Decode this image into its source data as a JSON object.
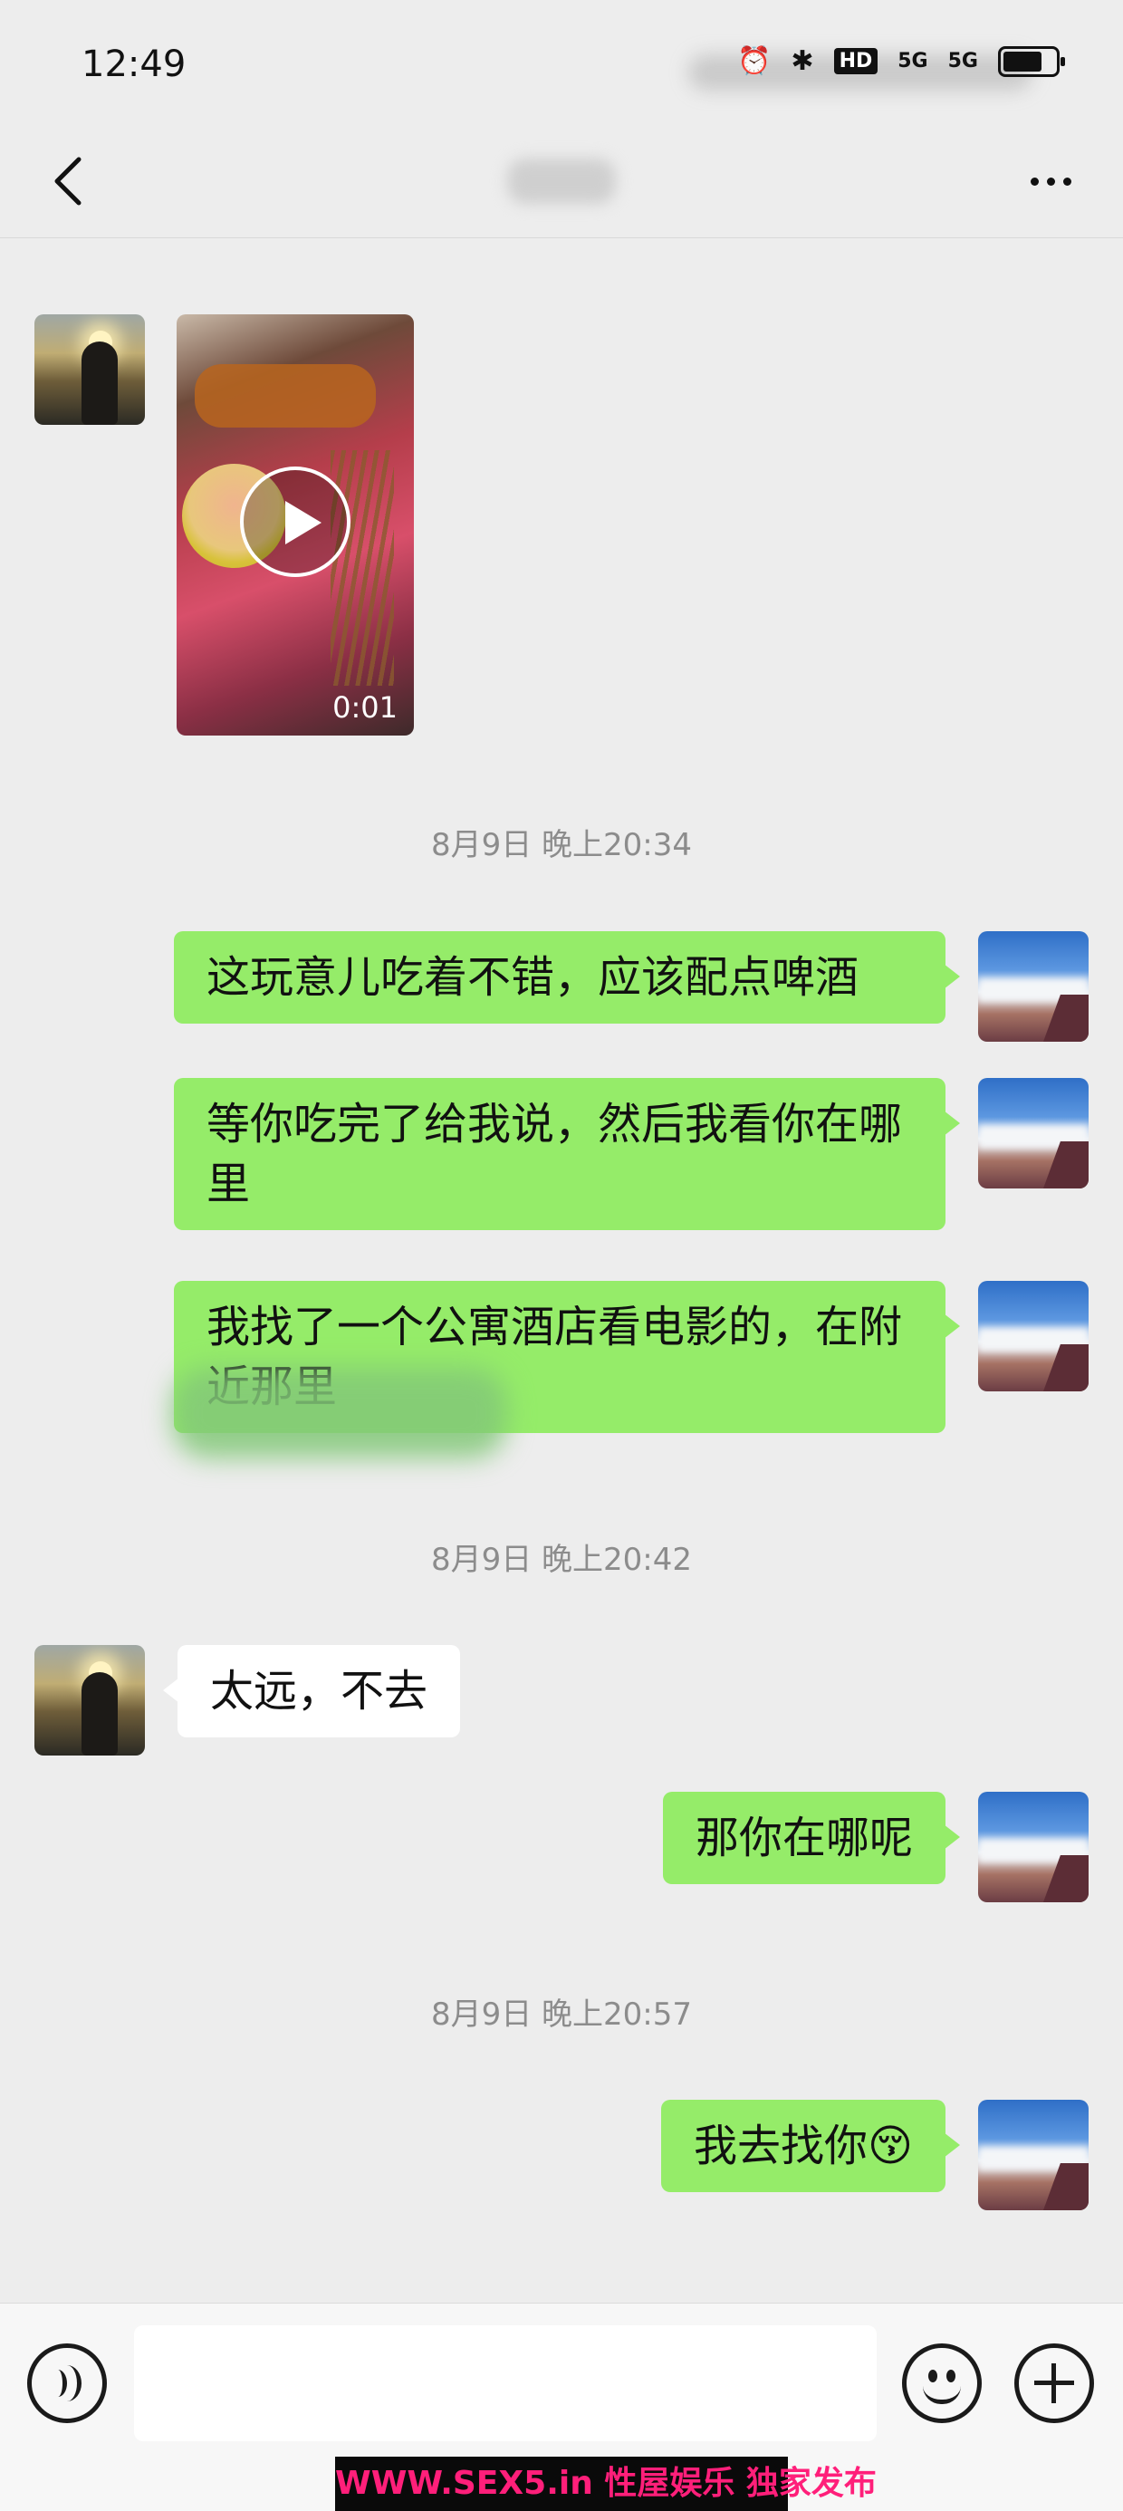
{
  "status_bar": {
    "time": "12:49",
    "hd_label": "HD",
    "signal_1": "5G",
    "signal_2": "5G"
  },
  "nav": {
    "back_icon": "chevron-left-icon",
    "more_icon": "more-dots-icon"
  },
  "messages": [
    {
      "type": "video",
      "side": "left",
      "duration": "0:01"
    },
    {
      "type": "timestamp",
      "text": "8月9日 晚上20:34"
    },
    {
      "type": "text",
      "side": "right",
      "text": "这玩意儿吃着不错，应该配点啤酒"
    },
    {
      "type": "text",
      "side": "right",
      "text": "等你吃完了给我说，然后我看你在哪里"
    },
    {
      "type": "text",
      "side": "right",
      "text": "我找了一个公寓酒店看电影的，在附近那里"
    },
    {
      "type": "timestamp",
      "text": "8月9日 晚上20:42"
    },
    {
      "type": "text",
      "side": "left",
      "text": "太远，不去"
    },
    {
      "type": "text",
      "side": "right",
      "text": "那你在哪呢"
    },
    {
      "type": "timestamp",
      "text": "8月9日 晚上20:57"
    },
    {
      "type": "text",
      "side": "right",
      "text": "我去找你😚"
    }
  ],
  "input_bar": {
    "value": "",
    "placeholder": ""
  },
  "watermark": "WWW.SEX5.in 性屋娱乐 独家发布",
  "colors": {
    "background": "#ededed",
    "bubble_right": "#95ec69",
    "bubble_left": "#ffffff",
    "timestamp": "#8c8c8c"
  }
}
